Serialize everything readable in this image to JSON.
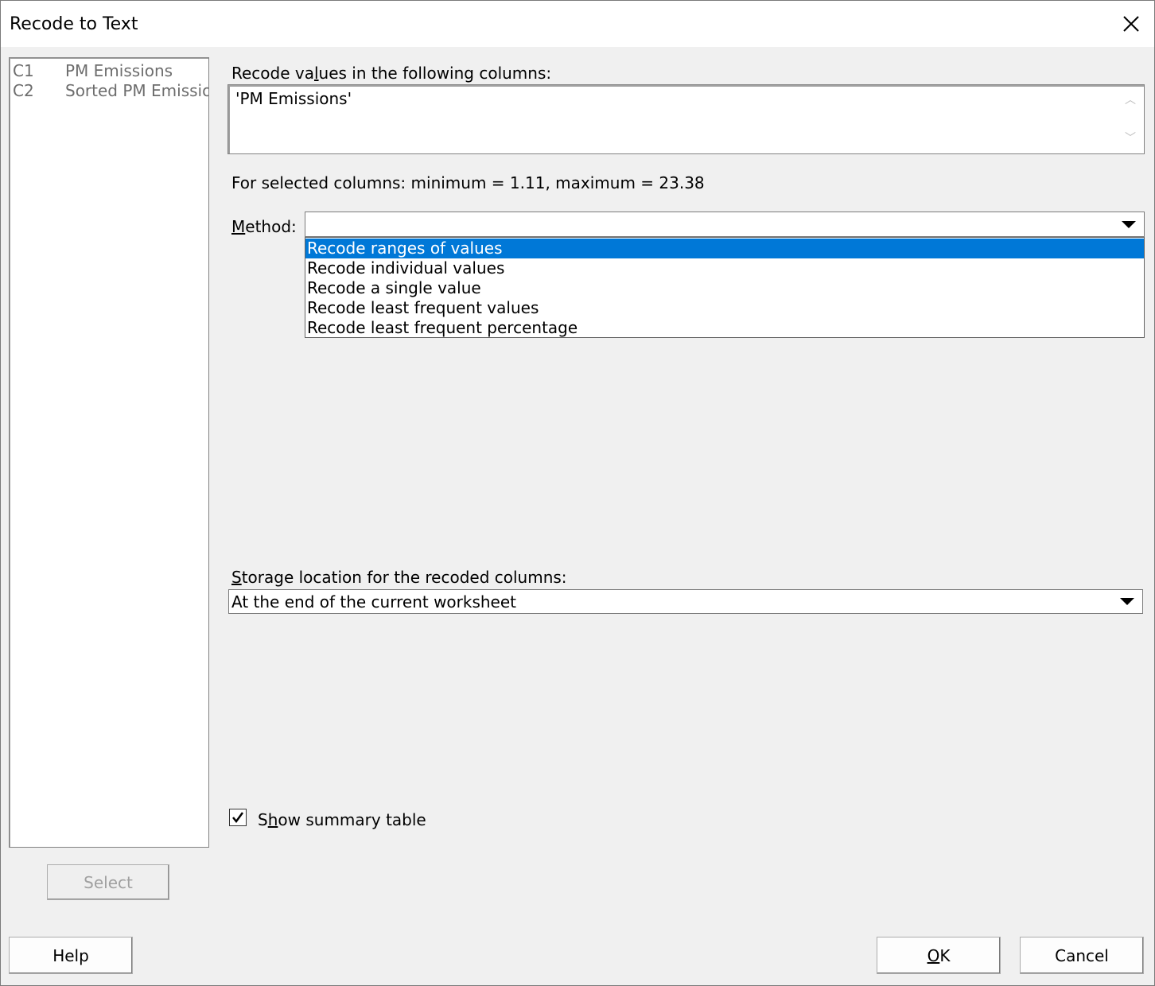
{
  "window": {
    "title": "Recode to Text"
  },
  "columns_list": [
    {
      "id": "C1",
      "name": "PM Emissions"
    },
    {
      "id": "C2",
      "name": "Sorted PM Emissior"
    }
  ],
  "select_label": "Select",
  "recode_cols": {
    "label_pre": "Recode va",
    "label_u": "l",
    "label_post": "ues in the following columns:",
    "value": "'PM Emissions'"
  },
  "stats_text": "For selected columns: minimum = 1.11, maximum = 23.38",
  "method": {
    "label_u": "M",
    "label_post": "ethod:",
    "value": "",
    "options": [
      "Recode ranges of values",
      "Recode individual values",
      "Recode a single value",
      "Recode least frequent values",
      "Recode least frequent percentage"
    ],
    "highlighted_index": 0
  },
  "storage": {
    "label_u": "S",
    "label_post": "torage location for the recoded columns:",
    "value": "At the end of the current worksheet"
  },
  "summary": {
    "label_pre": "S",
    "label_u": "h",
    "label_post": "ow summary table",
    "checked": true
  },
  "buttons": {
    "help": "Help",
    "ok_u": "O",
    "ok_post": "K",
    "cancel": "Cancel"
  },
  "colors": {
    "highlight": "#0078d7"
  }
}
